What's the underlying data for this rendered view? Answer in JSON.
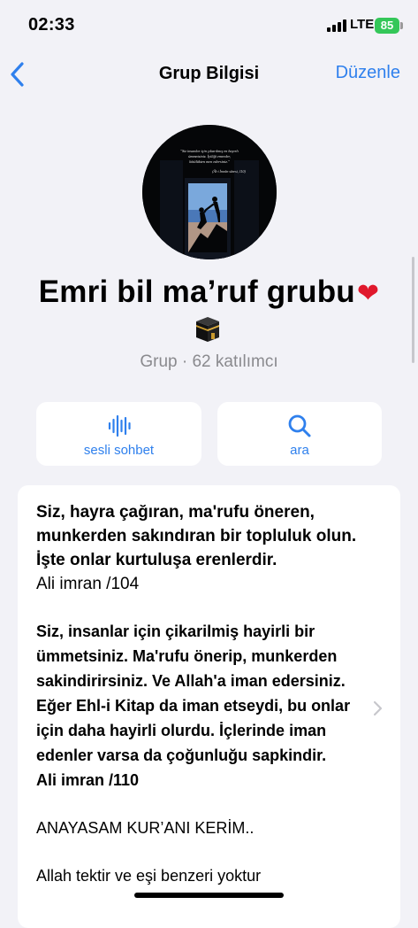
{
  "status_bar": {
    "time": "02:33",
    "network": "LTE",
    "battery": "85"
  },
  "nav": {
    "title": "Grup Bilgisi",
    "edit_label": "Düzenle"
  },
  "group": {
    "avatar_quote": "\"Siz insanlar için çıkarılmış en hayırlı ümmetsiniz. İyiliği emreder, kötülükten men edersiniz.\"",
    "avatar_source": "(Âl-i İmrân sûresi, 110)",
    "name": "Emri bil ma’ruf grubu",
    "heart": "❤",
    "subtitle": "Grup · 62 katılımcı"
  },
  "actions": {
    "voice_label": "sesli sohbet",
    "search_label": "ara"
  },
  "description": {
    "para1": "Siz, hayra çağıran, ma'rufu öneren, munkerden sakındıran bir topluluk olun. İşte onlar kurtuluşa erenlerdir.",
    "ref1": "Ali imran /104",
    "para2": "Siz, insanlar için çikarilmiş hayirli bir ümmetsiniz. Ma'rufu önerip, munkerden sakindirirsiniz. Ve Allah'a iman edersiniz. Eğer Ehl-i Kitap da iman etseydi, bu onlar için daha hayirli olurdu. İçlerinde iman edenler varsa da çoğunluğu sapkindir.",
    "ref2": "Ali imran  /110",
    "para3": "ANAYASAM KUR’ANI KERİM..",
    "para4": "Allah tektir ve eşi benzeri yoktur"
  },
  "colors": {
    "accent": "#2f80ed",
    "background": "#f2f2f7",
    "battery": "#34c759",
    "heart": "#e0182c",
    "secondary_text": "#8a8a8e"
  },
  "icons": {
    "back": "chevron-left-icon",
    "voice": "waveform-icon",
    "search": "magnifier-icon",
    "kaaba": "kaaba-icon",
    "disclosure": "chevron-right-icon"
  }
}
